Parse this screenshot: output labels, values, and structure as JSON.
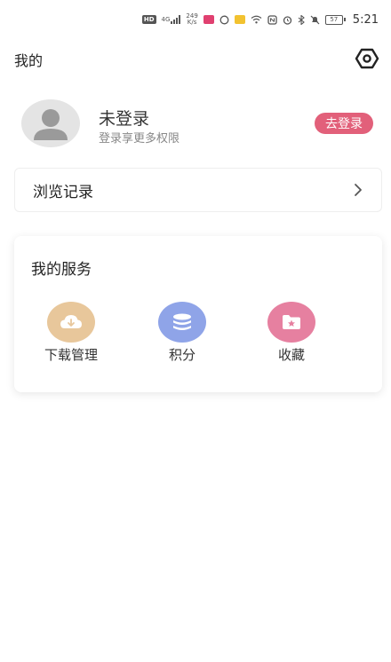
{
  "status_bar": {
    "network": "4G",
    "speed_value": "249",
    "speed_unit": "K/s",
    "battery": "57",
    "time": "5:21"
  },
  "header": {
    "title": "我的",
    "settings_icon": "settings-hexagon-icon"
  },
  "profile": {
    "name": "未登录",
    "subtitle": "登录享更多权限",
    "login_label": "去登录",
    "accent": "#e2607a"
  },
  "history": {
    "label": "浏览记录",
    "icon": "chevron-right-icon"
  },
  "services": {
    "title": "我的服务",
    "items": [
      {
        "label": "下载管理",
        "icon": "cloud-download-icon",
        "color": "#e8c79b"
      },
      {
        "label": "积分",
        "icon": "coins-stack-icon",
        "color": "#8fa4e8"
      },
      {
        "label": "收藏",
        "icon": "star-folder-icon",
        "color": "#e680a0"
      }
    ]
  }
}
